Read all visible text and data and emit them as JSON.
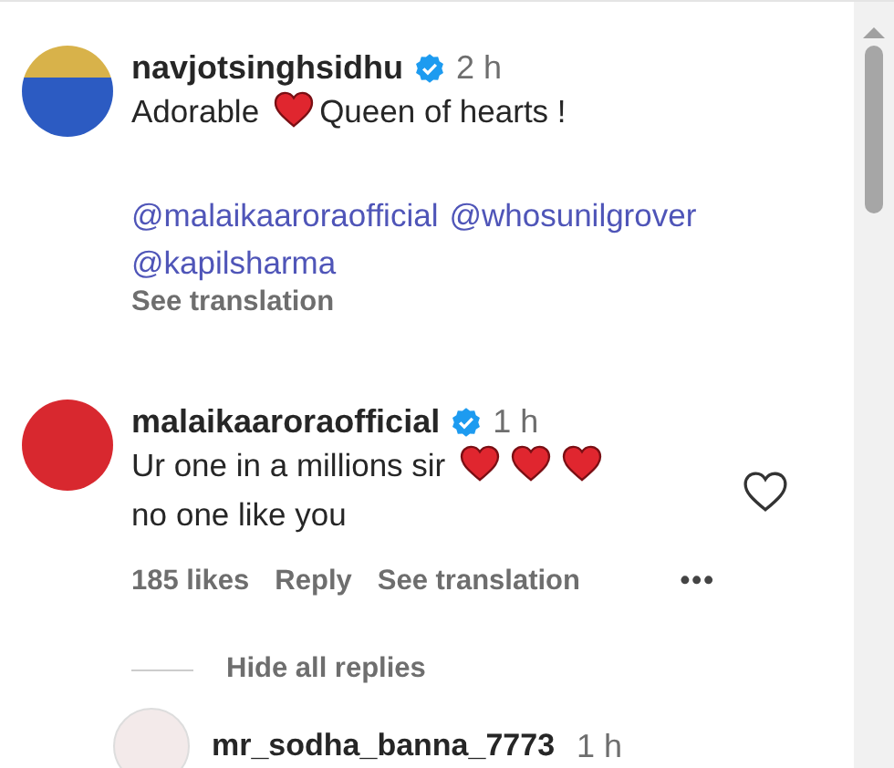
{
  "comment": {
    "username": "navjotsinghsidhu",
    "verified": true,
    "time": "2 h",
    "segments": [
      {
        "kind": "text",
        "text": "Adorable"
      },
      {
        "kind": "heart"
      },
      {
        "kind": "text",
        "text": "Queen of hearts !"
      }
    ],
    "mentions": [
      "@malaikaaroraofficial",
      "@whosunilgrover",
      "@kapilsharma"
    ],
    "see_translation": "See translation"
  },
  "reply": {
    "username": "malaikaaroraofficial",
    "verified": true,
    "time": "1 h",
    "segments": [
      {
        "kind": "text",
        "text": "Ur one in a millions sir"
      },
      {
        "kind": "heart"
      },
      {
        "kind": "heart"
      },
      {
        "kind": "heart"
      },
      {
        "kind": "text",
        "text": "no"
      },
      {
        "kind": "text",
        "text": "one like you"
      }
    ],
    "liked": false,
    "likes": "185 likes",
    "reply_button": "Reply",
    "see_translation": "See translation",
    "more": "•••"
  },
  "hide_replies": "Hide all replies",
  "next_reply": {
    "username": "mr_sodha_banna_7773",
    "time": "1 h"
  }
}
